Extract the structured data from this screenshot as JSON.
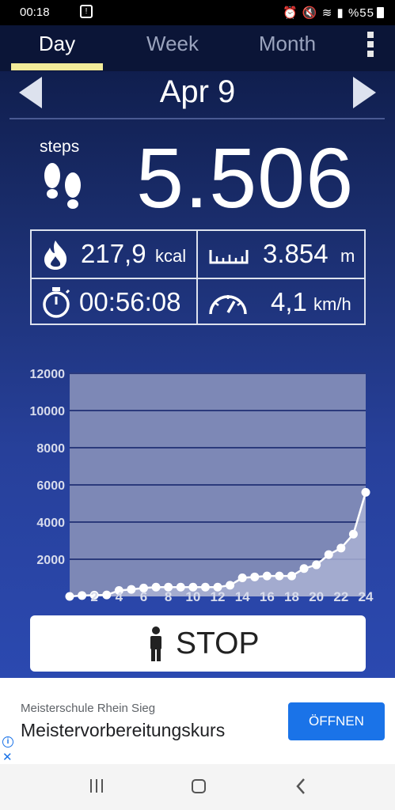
{
  "status_bar": {
    "time": "00:18",
    "battery": "%55"
  },
  "tabs": [
    {
      "label": "Day",
      "active": true
    },
    {
      "label": "Week",
      "active": false
    },
    {
      "label": "Month",
      "active": false
    }
  ],
  "date": "Apr 9",
  "steps": {
    "label": "steps",
    "count": "5.506"
  },
  "stats": {
    "calories": {
      "value": "217,9",
      "unit": "kcal",
      "icon": "flame-icon"
    },
    "distance": {
      "value": "3.854",
      "unit": "m",
      "icon": "ruler-icon"
    },
    "duration": {
      "value": "00:56:08",
      "icon": "stopwatch-icon"
    },
    "speed": {
      "value": "4,1",
      "unit": "km/h",
      "icon": "speedometer-icon"
    }
  },
  "chart_data": {
    "type": "area",
    "x": [
      0,
      1,
      2,
      3,
      4,
      5,
      6,
      7,
      8,
      9,
      10,
      11,
      12,
      13,
      14,
      15,
      16,
      17,
      18,
      19,
      20,
      21,
      22,
      23,
      24
    ],
    "values": [
      0,
      50,
      70,
      80,
      320,
      380,
      450,
      500,
      500,
      500,
      500,
      500,
      500,
      600,
      1000,
      1050,
      1100,
      1100,
      1100,
      1500,
      1700,
      2250,
      2600,
      3350,
      5600
    ],
    "x_tick_labels": [
      "2",
      "4",
      "6",
      "8",
      "10",
      "12",
      "14",
      "16",
      "18",
      "20",
      "22",
      "24"
    ],
    "y_tick_labels": [
      "2000",
      "4000",
      "6000",
      "8000",
      "10000",
      "12000"
    ],
    "ylim": [
      0,
      12000
    ],
    "xlim": [
      0,
      24
    ],
    "grid": true,
    "colors": {
      "plot_bg": "#7d88b6",
      "gridline": "#2b3a7c",
      "line": "#ffffff",
      "area": "#a9b1d3"
    }
  },
  "stop_button": {
    "label": "STOP"
  },
  "ad": {
    "advertiser": "Meisterschule Rhein Sieg",
    "title": "Meistervorbereitungskurs",
    "button": "ÖFFNEN"
  }
}
